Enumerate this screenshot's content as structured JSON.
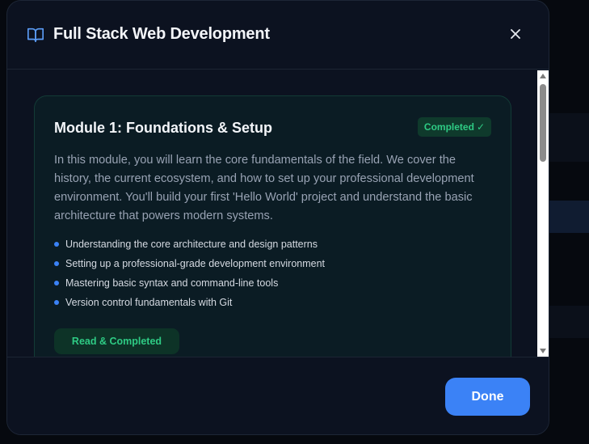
{
  "modal": {
    "title": "Full Stack Web Development",
    "header_icon": "book-open-icon",
    "close_icon": "close-icon"
  },
  "module": {
    "title": "Module 1: Foundations & Setup",
    "status": "Completed",
    "status_icon": "✓",
    "description": "In this module, you will learn the core fundamentals of the field. We cover the history, the current ecosystem, and how to set up your professional development environment. You'll build your first 'Hello World' project and understand the basic architecture that powers modern systems.",
    "topics": [
      "Understanding the core architecture and design patterns",
      "Setting up a professional-grade development environment",
      "Mastering basic syntax and command-line tools",
      "Version control fundamentals with Git"
    ],
    "action_label": "Read & Completed"
  },
  "footer": {
    "done_label": "Done"
  },
  "colors": {
    "accent": "#3b82f6",
    "success": "#2ecb84",
    "surface": "#0c1220",
    "card": "#0b1c24"
  }
}
